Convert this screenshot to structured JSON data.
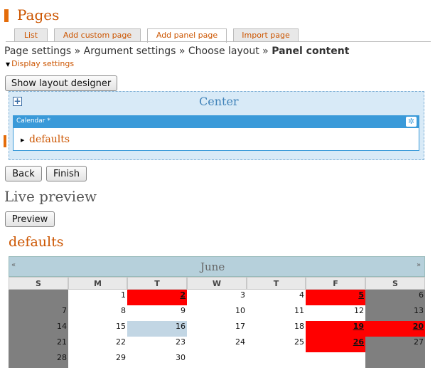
{
  "page": {
    "title": "Pages",
    "tabs": [
      {
        "label": "List"
      },
      {
        "label": "Add custom page"
      },
      {
        "label": "Add panel page"
      },
      {
        "label": "Import page"
      }
    ],
    "breadcrumb": {
      "step1": "Page settings",
      "sep": "»",
      "step2": "Argument settings",
      "step3": "Choose layout",
      "step4": "Panel content"
    },
    "display_settings": "Display settings",
    "buttons": {
      "show_layout_designer": "Show layout designer",
      "back": "Back",
      "finish": "Finish",
      "preview": "Preview"
    },
    "panel": {
      "region_label": "Center",
      "pane_title": "Calendar *",
      "pane_content": "defaults"
    },
    "live_preview": "Live preview",
    "preview_title": "defaults"
  },
  "calendar": {
    "month": "June",
    "prev": "«",
    "next": "»",
    "weekdays": [
      "S",
      "M",
      "T",
      "W",
      "T",
      "F",
      "S"
    ],
    "weeks": [
      [
        "",
        "1",
        "2",
        "3",
        "4",
        "5",
        "6"
      ],
      [
        "7",
        "8",
        "9",
        "10",
        "11",
        "12",
        "13"
      ],
      [
        "14",
        "15",
        "16",
        "17",
        "18",
        "19",
        "20"
      ],
      [
        "21",
        "22",
        "23",
        "24",
        "25",
        "26",
        "27"
      ],
      [
        "28",
        "29",
        "30",
        "",
        "",
        "",
        ""
      ]
    ],
    "event_days": [
      "2",
      "5",
      "19",
      "20",
      "26"
    ],
    "today": "16",
    "colors": {
      "event": "#ff0000",
      "weekend": "#7f7f7f",
      "today": "#c2d6e4",
      "header": "#b6d0db",
      "accent": "#cc5500"
    }
  }
}
